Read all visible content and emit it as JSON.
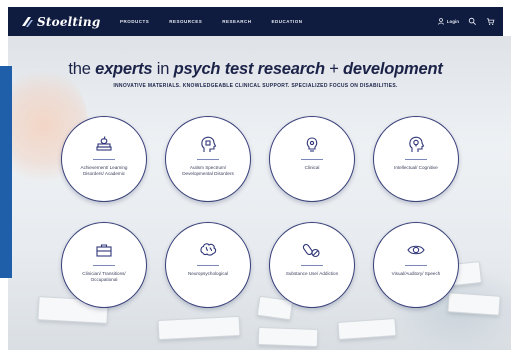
{
  "brand": {
    "name": "Stoelting",
    "sub": ""
  },
  "nav": {
    "links": [
      "PRODUCTS",
      "RESOURCES",
      "RESEARCH",
      "EDUCATION"
    ],
    "login": "Login"
  },
  "hero": {
    "headline": {
      "part1": "the ",
      "em1": "experts",
      "part2": " in ",
      "em2": "psych test research",
      "part3": " + ",
      "em3": "development"
    },
    "tagline": "INNOVATIVE MATERIALS. KNOWLEDGEABLE CLINICAL SUPPORT. SPECIALIZED FOCUS ON DISABILITIES."
  },
  "categories": [
    {
      "label": "Achievement/ Learning Disorders/ Academic",
      "icon": "apple-on-books-icon"
    },
    {
      "label": "Autism Spectrum/ Developmental Disorders",
      "icon": "head-puzzle-icon"
    },
    {
      "label": "Clinical",
      "icon": "gear-bulb-icon"
    },
    {
      "label": "Intellectual/ Cognitive",
      "icon": "head-bulb-icon"
    },
    {
      "label": "Clinician/ Transitions/ Occupational",
      "icon": "briefcase-icon"
    },
    {
      "label": "Neuropsychological",
      "icon": "brain-icon"
    },
    {
      "label": "Substance Use/ Addiction",
      "icon": "pills-icon"
    },
    {
      "label": "Visual/Auditory/ Speech",
      "icon": "eye-icon"
    }
  ],
  "colors": {
    "navbar": "#0f1b3f",
    "accent_blue": "#1f5ea8",
    "circle_border": "#39407a",
    "text": "#1c2348"
  }
}
